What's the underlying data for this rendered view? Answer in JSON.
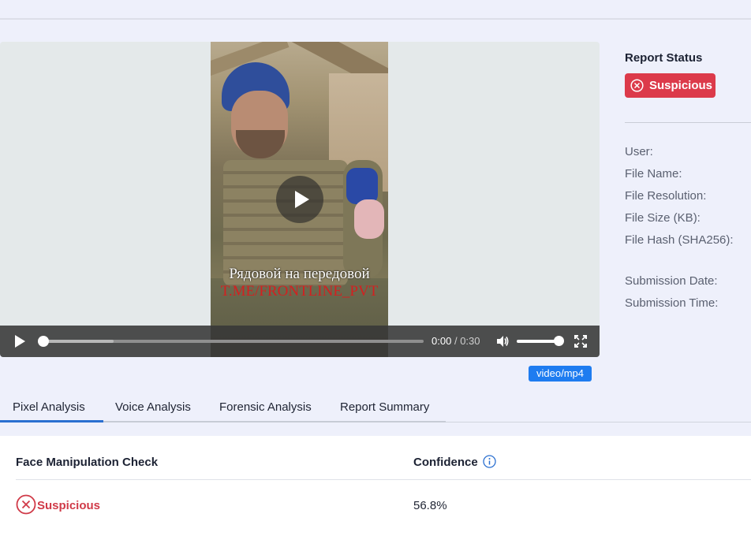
{
  "video": {
    "caption_line1": "Рядовой на передовой",
    "caption_line2": "T.ME/FRONTLINE_PVT",
    "current_time": "0:00",
    "time_separator": "/",
    "duration": "0:30",
    "progress_fraction": 0.0,
    "buffered_fraction": 0.19,
    "volume_fraction": 1.0,
    "mime_type": "video/mp4",
    "icons": [
      "play-icon",
      "volume-icon",
      "fullscreen-icon"
    ]
  },
  "report": {
    "title": "Report Status",
    "status_label": "Suspicious",
    "status_color": "#dc3a4a",
    "fields": [
      {
        "label": "User:"
      },
      {
        "label": "File Name:"
      },
      {
        "label": "File Resolution:"
      },
      {
        "label": "File Size (KB):"
      },
      {
        "label": "File Hash (SHA256):"
      },
      {
        "label": "Submission Date:"
      },
      {
        "label": "Submission Time:"
      }
    ]
  },
  "tabs": [
    {
      "label": "Pixel Analysis",
      "active": true
    },
    {
      "label": "Voice Analysis",
      "active": false
    },
    {
      "label": "Forensic Analysis",
      "active": false
    },
    {
      "label": "Report Summary",
      "active": false
    }
  ],
  "results": {
    "headers": {
      "check": "Face Manipulation Check",
      "confidence": "Confidence"
    },
    "rows": [
      {
        "check_result": "Suspicious",
        "confidence": "56.8%"
      }
    ],
    "accent_color": "#2a6fd0",
    "suspicious_color": "#d03a48"
  }
}
